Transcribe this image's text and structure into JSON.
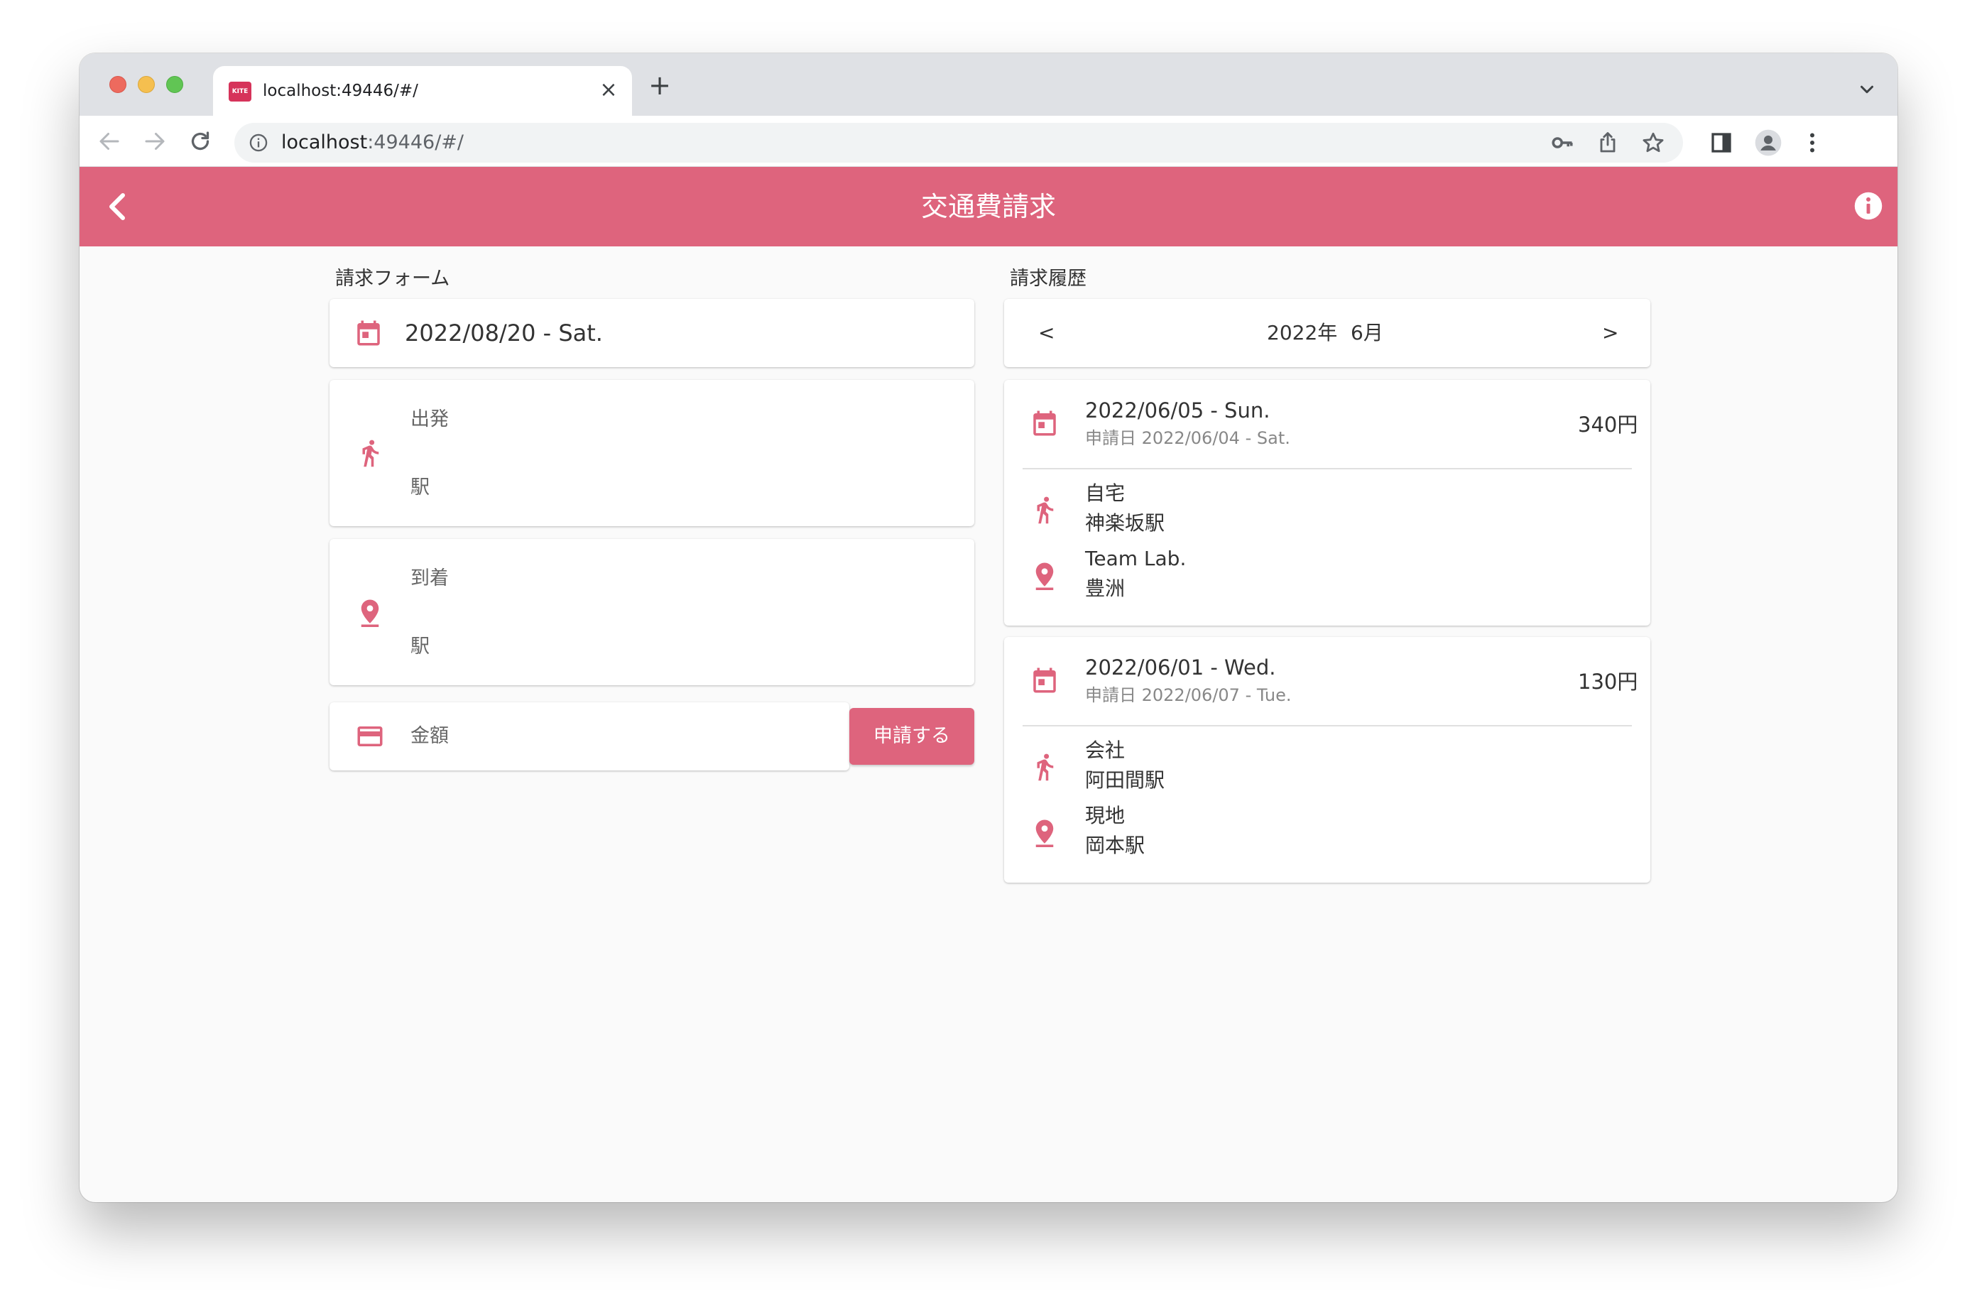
{
  "browser": {
    "tab_title": "localhost:49446/#/",
    "favicon_text": "KITE",
    "url_host": "localhost",
    "url_rest": ":49446/#/",
    "close_glyph": "×",
    "new_tab_glyph": "+"
  },
  "app": {
    "title": "交通費請求",
    "accent": "#de647d"
  },
  "form": {
    "section_label": "請求フォーム",
    "date": "2022/08/20 - Sat.",
    "departure": {
      "label": "出発",
      "station_placeholder": "駅"
    },
    "arrival": {
      "label": "到着",
      "station_placeholder": "駅"
    },
    "amount_placeholder": "金額",
    "submit_label": "申請する"
  },
  "history": {
    "section_label": "請求履歴",
    "prev": "<",
    "next": ">",
    "year": "2022年",
    "month": "6月",
    "items": [
      {
        "date": "2022/06/05 - Sun.",
        "applied": "申請日 2022/06/04 - Sat.",
        "amount": "340円",
        "from_name": "自宅",
        "from_station": "神楽坂駅",
        "to_name": "Team Lab.",
        "to_station": "豊洲"
      },
      {
        "date": "2022/06/01 - Wed.",
        "applied": "申請日 2022/06/07 - Tue.",
        "amount": "130円",
        "from_name": "会社",
        "from_station": "阿田間駅",
        "to_name": "現地",
        "to_station": "岡本駅"
      }
    ]
  }
}
